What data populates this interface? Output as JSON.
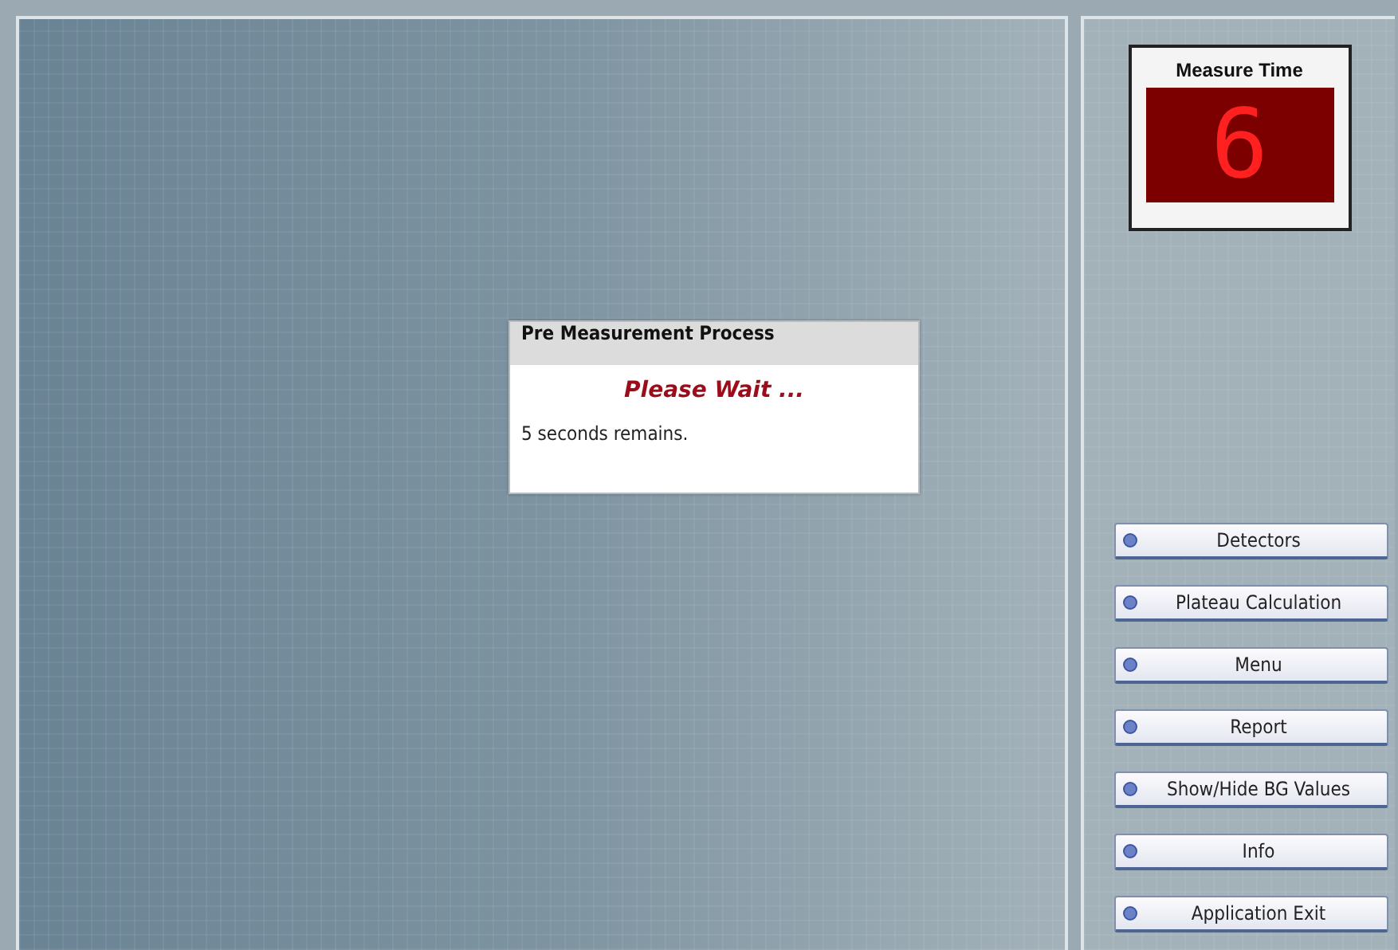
{
  "dialog": {
    "title": "Pre Measurement Process",
    "status": "Please Wait ...",
    "message": "5 seconds remains."
  },
  "timer": {
    "label": "Measure Time",
    "value": "6"
  },
  "buttons": [
    {
      "label": "Detectors"
    },
    {
      "label": "Plateau Calculation"
    },
    {
      "label": "Menu"
    },
    {
      "label": "Report"
    },
    {
      "label": "Show/Hide BG Values"
    },
    {
      "label": "Info"
    },
    {
      "label": "Application Exit"
    }
  ]
}
